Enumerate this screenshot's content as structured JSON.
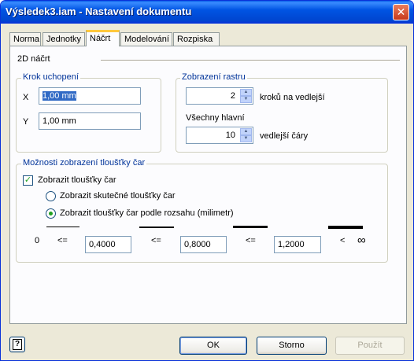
{
  "window": {
    "title": "Výsledek3.iam - Nastavení dokumentu",
    "close_glyph": "✕"
  },
  "tabs": [
    "Norma",
    "Jednotky",
    "Náčrt",
    "Modelování",
    "Rozpiska"
  ],
  "active_tab": "Náčrt",
  "panel": {
    "heading": "2D náčrt",
    "snap": {
      "title": "Krok uchopení",
      "x_label": "X",
      "x_value": "1,00 mm",
      "y_label": "Y",
      "y_value": "1,00 mm"
    },
    "grid": {
      "title": "Zobrazení rastru",
      "minor_value": "2",
      "minor_label": "kroků na vedlejší",
      "major_label": "Všechny hlavní",
      "major_value": "10",
      "major_suffix": "vedlejší čáry"
    },
    "lineweight": {
      "title": "Možnosti zobrazení tloušťky čar",
      "show_label": "Zobrazit tloušťky čar",
      "show_checked": true,
      "radio_actual": "Zobrazit skutečné tloušťky čar",
      "radio_range": "Zobrazit tloušťky čar podle rozsahu (milimetr)",
      "selected": "range",
      "zero": "0",
      "le_symbol": "<=",
      "lt_symbol": "<",
      "infinity": "∞",
      "value1": "0,4000",
      "value2": "0,8000",
      "value3": "1,2000"
    }
  },
  "footer": {
    "ok": "OK",
    "cancel": "Storno",
    "apply": "Použít",
    "help_glyph": "?"
  },
  "icons": [
    "close-icon",
    "help-icon",
    "spin-up-icon",
    "spin-down-icon",
    "checkmark-icon",
    "radio-dot-icon"
  ]
}
